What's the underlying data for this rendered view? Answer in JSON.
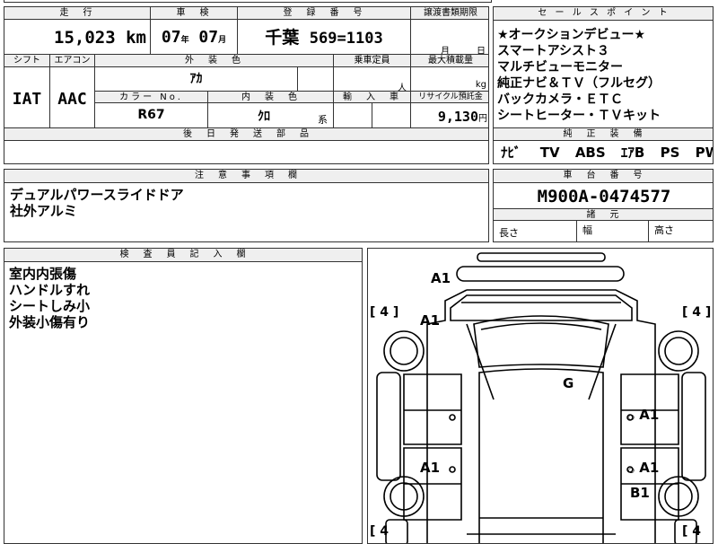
{
  "headers": {
    "mileage": "走　行",
    "inspection": "車　検",
    "registration": "登　録　番　号",
    "transfer_deadline": "譲渡書類期限",
    "shift": "シフト",
    "aircon": "エアコン",
    "exterior_color": "外　装　色",
    "capacity": "乗車定員",
    "max_load": "最大積載量",
    "color_no": "カラー No.",
    "interior_color": "内　装　色",
    "imported": "輸　入　車",
    "recycle_fee": "リサイクル預託金",
    "later_parts": "後　日　発　送　部　品",
    "sales_points": "セ ー ル ス ポ イ ン ト",
    "standard_equipment": "純　正　装　備",
    "notes": "注　意　事　項　欄",
    "chassis_no": "車　台　番　号",
    "dimensions": "諸　元",
    "inspector_notes": "検　査　員　記　入　欄"
  },
  "values": {
    "mileage": "15,023",
    "mileage_unit": "km",
    "inspection_year": "07",
    "year_unit": "年",
    "inspection_month": "07",
    "month_unit": "月",
    "plate_region": "千葉",
    "plate_number": "569",
    "plate_serial": "1103",
    "deadline_month_unit": "月",
    "deadline_day_unit": "日",
    "shift": "IAT",
    "aircon": "AAC",
    "exterior_color": "ｱｶ",
    "capacity_unit": "人",
    "max_load_unit": "kg",
    "color_no": "R67",
    "interior_color": "ｸﾛ",
    "interior_suffix": "系",
    "recycle_fee": "9,130",
    "recycle_unit": "円",
    "chassis_no": "M900A-0474577",
    "length_label": "長さ",
    "width_label": "幅",
    "height_label": "高さ"
  },
  "sales_points": [
    "★オークションデビュー★",
    "スマートアシスト３",
    "マルチビューモニター",
    "純正ナビ＆ＴＶ（フルセグ）",
    "バックカメラ・ＥＴＣ",
    "シートヒーター・ＴＶキット"
  ],
  "standard_equipment": [
    "ﾅﾋﾞ",
    "TV",
    "ABS",
    "ｴｱB",
    "PS",
    "PW"
  ],
  "notes": [
    "デュアルパワースライドドア",
    "社外アルミ"
  ],
  "inspector_notes": [
    "室内内張傷",
    "ハンドルすれ",
    "シートしみ小",
    "外装小傷有り"
  ],
  "diagram": {
    "tire_labels": {
      "front_left": "[ 4 ]",
      "front_right": "[ 4 ]",
      "rear_left": "[ 4",
      "rear_right": "[ 4"
    },
    "marks": {
      "front_bumper": "A1",
      "front_left_fender": "A1",
      "roof": "G",
      "right_front_door": "A1",
      "left_rear_door": "A1",
      "right_rear_door": "A1",
      "right_rear_quarter": "B1"
    }
  }
}
